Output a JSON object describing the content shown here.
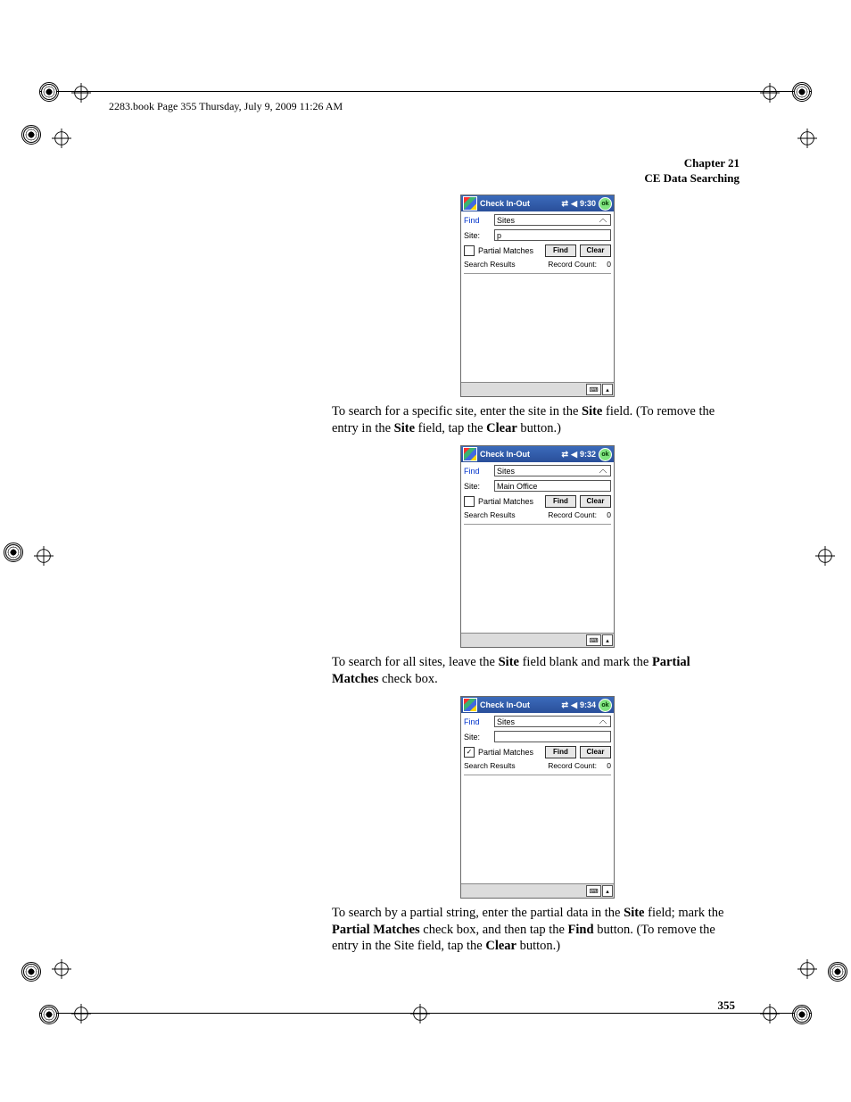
{
  "header": {
    "running_head": "2283.book  Page 355  Thursday, July 9, 2009  11:26 AM"
  },
  "chapter": {
    "line1": "Chapter 21",
    "line2": "CE Data Searching"
  },
  "page_number": "355",
  "screens": [
    {
      "title": "Check In-Out",
      "time": "9:30",
      "find_lbl": "Find",
      "find_val": "Sites",
      "site_lbl": "Site:",
      "site_val": "p",
      "partial_checked": false,
      "partial_lbl": "Partial Matches",
      "find_btn": "Find",
      "clear_btn": "Clear",
      "results_lbl": "Search Results",
      "count_lbl": "Record Count:",
      "count_val": "0",
      "ok": "ok"
    },
    {
      "title": "Check In-Out",
      "time": "9:32",
      "find_lbl": "Find",
      "find_val": "Sites",
      "site_lbl": "Site:",
      "site_val": "Main Office",
      "partial_checked": false,
      "partial_lbl": "Partial Matches",
      "find_btn": "Find",
      "clear_btn": "Clear",
      "results_lbl": "Search Results",
      "count_lbl": "Record Count:",
      "count_val": "0",
      "ok": "ok"
    },
    {
      "title": "Check In-Out",
      "time": "9:34",
      "find_lbl": "Find",
      "find_val": "Sites",
      "site_lbl": "Site:",
      "site_val": "",
      "partial_checked": true,
      "partial_lbl": "Partial Matches",
      "find_btn": "Find",
      "clear_btn": "Clear",
      "results_lbl": "Search Results",
      "count_lbl": "Record Count:",
      "count_val": "0",
      "ok": "ok"
    }
  ],
  "paras": {
    "p1a": "To search for a specific site, enter the site in the ",
    "p1b": "Site",
    "p1c": " field. (To remove the entry in the ",
    "p1d": "Site",
    "p1e": " field, tap the ",
    "p1f": "Clear",
    "p1g": " button.)",
    "p2a": "To search for all sites, leave the ",
    "p2b": "Site",
    "p2c": " field blank and mark the ",
    "p2d": "Partial Matches",
    "p2e": " check box.",
    "p3a": "To search by a partial string, enter the partial data in the ",
    "p3b": "Site",
    "p3c": " field; mark the ",
    "p3d": "Partial Matches",
    "p3e": " check box, and then tap the ",
    "p3f": "Find",
    "p3g": " button. (To remove the entry in the Site field, tap the ",
    "p3h": "Clear",
    "p3i": " button.)"
  },
  "icons": {
    "signal": "⇄",
    "sound": "◀",
    "check": "✓",
    "kbd": "⌨",
    "up": "▴"
  }
}
